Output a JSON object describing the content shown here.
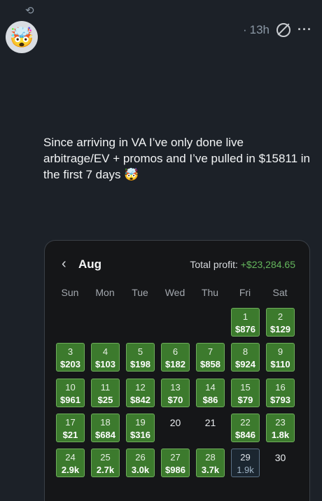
{
  "post": {
    "time": "13h",
    "dot": "·",
    "text": "Since arriving in VA I’ve only done live arbitrage/EV + promos and I’ve pulled in $15811 in the first 7 days",
    "emoji": "🤯"
  },
  "icons": {
    "repost": "repost-icon",
    "slash": "slash-circle-icon",
    "more": "more-icon",
    "back": "chevron-left-icon"
  },
  "calendar": {
    "month": "Aug",
    "total_label": "Total profit: ",
    "total_value": "+$23,284.65",
    "weekdays": [
      "Sun",
      "Mon",
      "Tue",
      "Wed",
      "Thu",
      "Fri",
      "Sat"
    ],
    "days": [
      {
        "day": "1",
        "value": "$876",
        "state": "profit"
      },
      {
        "day": "2",
        "value": "$129",
        "state": "profit"
      },
      {
        "day": "3",
        "value": "$203",
        "state": "profit"
      },
      {
        "day": "4",
        "value": "$103",
        "state": "profit"
      },
      {
        "day": "5",
        "value": "$198",
        "state": "profit"
      },
      {
        "day": "6",
        "value": "$182",
        "state": "profit"
      },
      {
        "day": "7",
        "value": "$858",
        "state": "profit"
      },
      {
        "day": "8",
        "value": "$924",
        "state": "profit"
      },
      {
        "day": "9",
        "value": "$110",
        "state": "profit"
      },
      {
        "day": "10",
        "value": "$961",
        "state": "profit"
      },
      {
        "day": "11",
        "value": "$25",
        "state": "profit"
      },
      {
        "day": "12",
        "value": "$842",
        "state": "profit"
      },
      {
        "day": "13",
        "value": "$70",
        "state": "profit"
      },
      {
        "day": "14",
        "value": "$86",
        "state": "profit"
      },
      {
        "day": "15",
        "value": "$79",
        "state": "profit"
      },
      {
        "day": "16",
        "value": "$793",
        "state": "profit"
      },
      {
        "day": "17",
        "value": "$21",
        "state": "profit"
      },
      {
        "day": "18",
        "value": "$684",
        "state": "profit"
      },
      {
        "day": "19",
        "value": "$316",
        "state": "profit"
      },
      {
        "day": "20",
        "value": "",
        "state": "none"
      },
      {
        "day": "21",
        "value": "",
        "state": "none"
      },
      {
        "day": "22",
        "value": "$846",
        "state": "profit"
      },
      {
        "day": "23",
        "value": "1.8k",
        "state": "profit"
      },
      {
        "day": "24",
        "value": "2.9k",
        "state": "profit"
      },
      {
        "day": "25",
        "value": "2.7k",
        "state": "profit"
      },
      {
        "day": "26",
        "value": "3.0k",
        "state": "profit"
      },
      {
        "day": "27",
        "value": "$986",
        "state": "profit"
      },
      {
        "day": "28",
        "value": "3.7k",
        "state": "profit"
      },
      {
        "day": "29",
        "value": "1.9k",
        "state": "pending"
      },
      {
        "day": "30",
        "value": "",
        "state": "none"
      }
    ]
  },
  "colors": {
    "profit": "#3c7a2d",
    "profit_border": "#6fae5b",
    "total": "#64b65c",
    "pending_border": "#5b7186"
  }
}
